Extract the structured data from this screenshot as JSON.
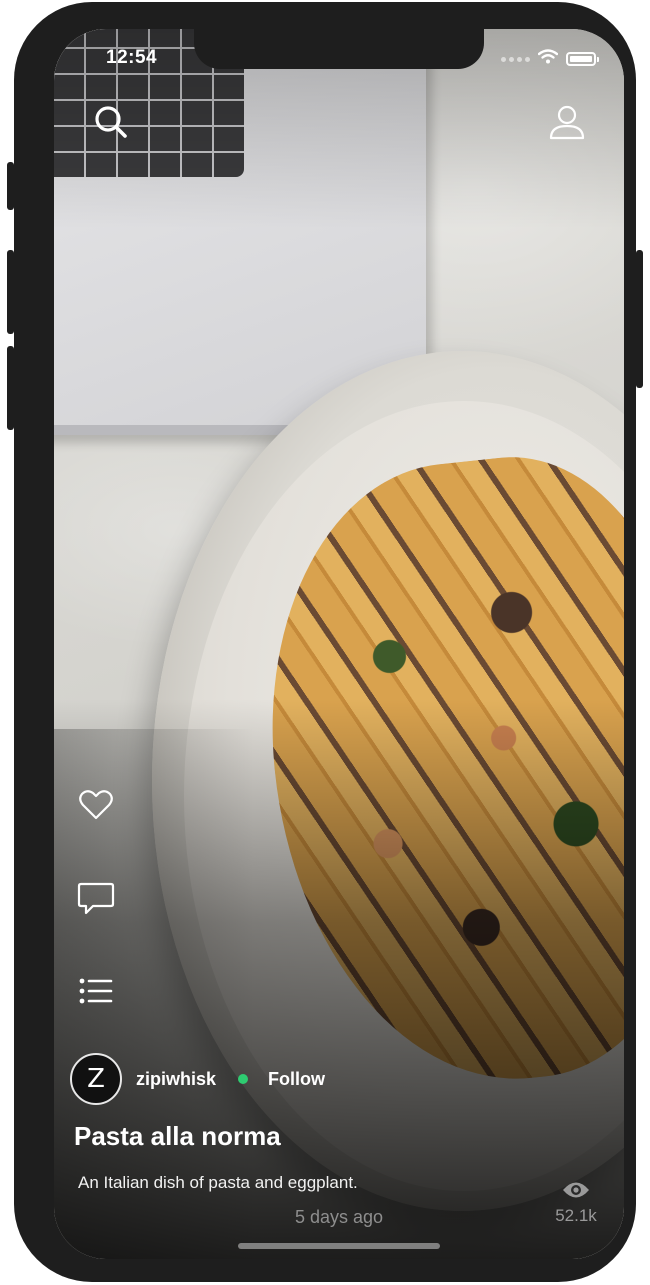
{
  "status_bar": {
    "time": "12:54",
    "wifi_icon": "wifi-icon",
    "battery_icon": "battery-icon"
  },
  "top_bar": {
    "search_icon": "search-icon",
    "profile_icon": "user-icon"
  },
  "actions": {
    "like_icon": "heart-icon",
    "comment_icon": "comment-icon",
    "list_icon": "list-icon"
  },
  "post": {
    "author": {
      "avatar_initial": "Z",
      "username": "zipiwhisk",
      "online_color": "#2ecc71",
      "follow_label": "Follow"
    },
    "title": "Pasta alla norma",
    "description": "An Italian dish of pasta and eggplant.",
    "posted": "5 days ago",
    "views": "52.1k",
    "views_icon": "eye-icon"
  },
  "colors": {
    "text_primary": "#ffffff",
    "text_muted": "#8e8e8e",
    "device_frame": "#1e1e1e"
  }
}
